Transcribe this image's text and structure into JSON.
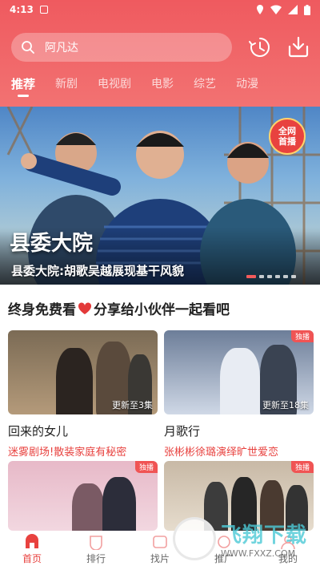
{
  "status_bar": {
    "time": "4:13"
  },
  "search": {
    "value": "阿凡达"
  },
  "tabs": [
    {
      "label": "推荐",
      "active": true
    },
    {
      "label": "新剧"
    },
    {
      "label": "电视剧"
    },
    {
      "label": "电影"
    },
    {
      "label": "综艺"
    },
    {
      "label": "动漫"
    }
  ],
  "banner": {
    "badge_line1": "全网",
    "badge_line2": "首播",
    "title": "县委大院",
    "subtitle": "县委大院:胡歌吴越展现基干风貌",
    "dot_count": 6,
    "active_dot": 0
  },
  "section": {
    "title_left": "终身免费看",
    "title_right": "分享给小伙伴一起看吧"
  },
  "cards": [
    {
      "title": "回来的女儿",
      "desc": "迷雾剧场!散装家庭有秘密",
      "episodes": "更新至3集",
      "tag": ""
    },
    {
      "title": "月歌行",
      "desc": "张彬彬徐璐演绎旷世爱恋",
      "episodes": "更新至18集",
      "tag": "独播"
    },
    {
      "title": "",
      "desc": "",
      "episodes": "",
      "tag": "独播"
    },
    {
      "title": "",
      "desc": "",
      "episodes": "",
      "tag": "独播"
    }
  ],
  "bottom_nav": [
    {
      "label": "首页",
      "active": true
    },
    {
      "label": "排行"
    },
    {
      "label": "找片"
    },
    {
      "label": "推广"
    },
    {
      "label": "我的"
    }
  ],
  "watermark": {
    "big": "飞翔下载",
    "small": "WWW.FXXZ.COM"
  },
  "colors": {
    "brand": "#ef5a5f",
    "accent_red": "#e8423f",
    "highlight_text": "#e8423f"
  }
}
